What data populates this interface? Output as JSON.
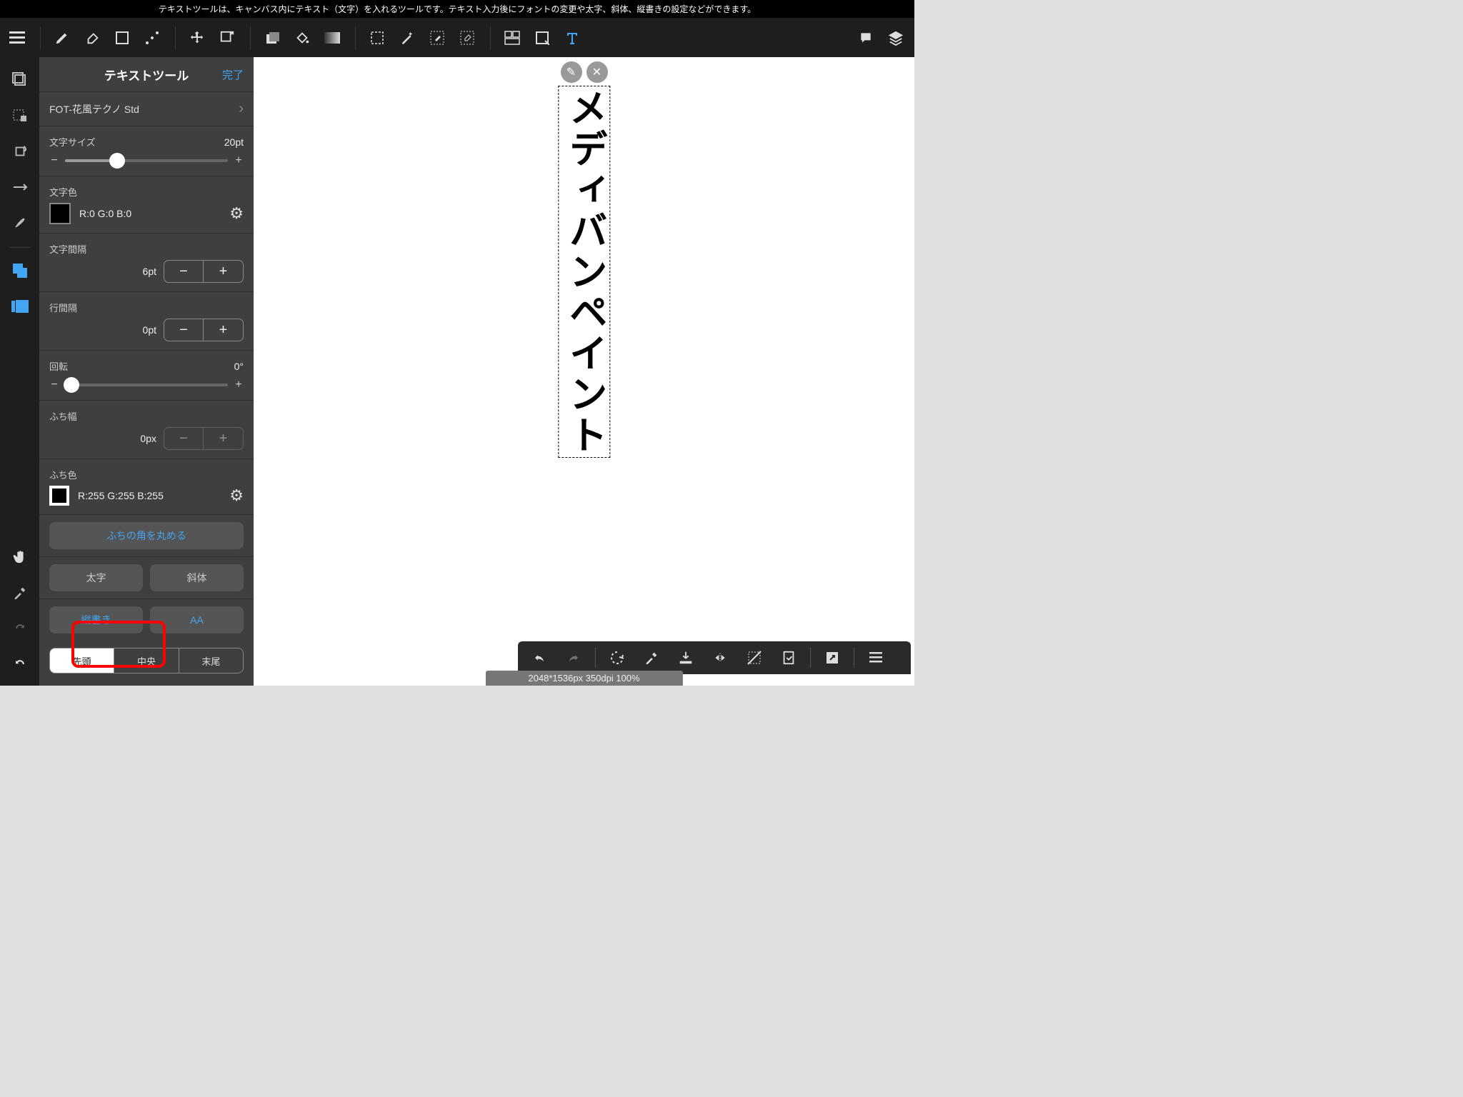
{
  "top_description": "テキストツールは、キャンバス内にテキスト（文字）を入れるツールです。テキスト入力後にフォントの変更や太字、斜体、縦書きの設定などができます。",
  "panel": {
    "title": "テキストツール",
    "done": "完了",
    "font_name": "FOT-花風テクノ Std",
    "font_size_label": "文字サイズ",
    "font_size_value": "20pt",
    "color_label": "文字色",
    "color_value": "R:0 G:0 B:0",
    "char_spacing_label": "文字間隔",
    "char_spacing_value": "6pt",
    "line_spacing_label": "行間隔",
    "line_spacing_value": "0pt",
    "rotation_label": "回転",
    "rotation_value": "0°",
    "edge_width_label": "ふち幅",
    "edge_width_value": "0px",
    "edge_color_label": "ふち色",
    "edge_color_value": "R:255 G:255 B:255",
    "round_corner": "ふちの角を丸める",
    "bold": "太字",
    "italic": "斜体",
    "vertical": "縦書き",
    "aa": "AA",
    "align_head": "先頭",
    "align_center": "中央",
    "align_end": "末尾"
  },
  "canvas_text": "メディバンペイント",
  "status_bar": "2048*1536px 350dpi 100%"
}
